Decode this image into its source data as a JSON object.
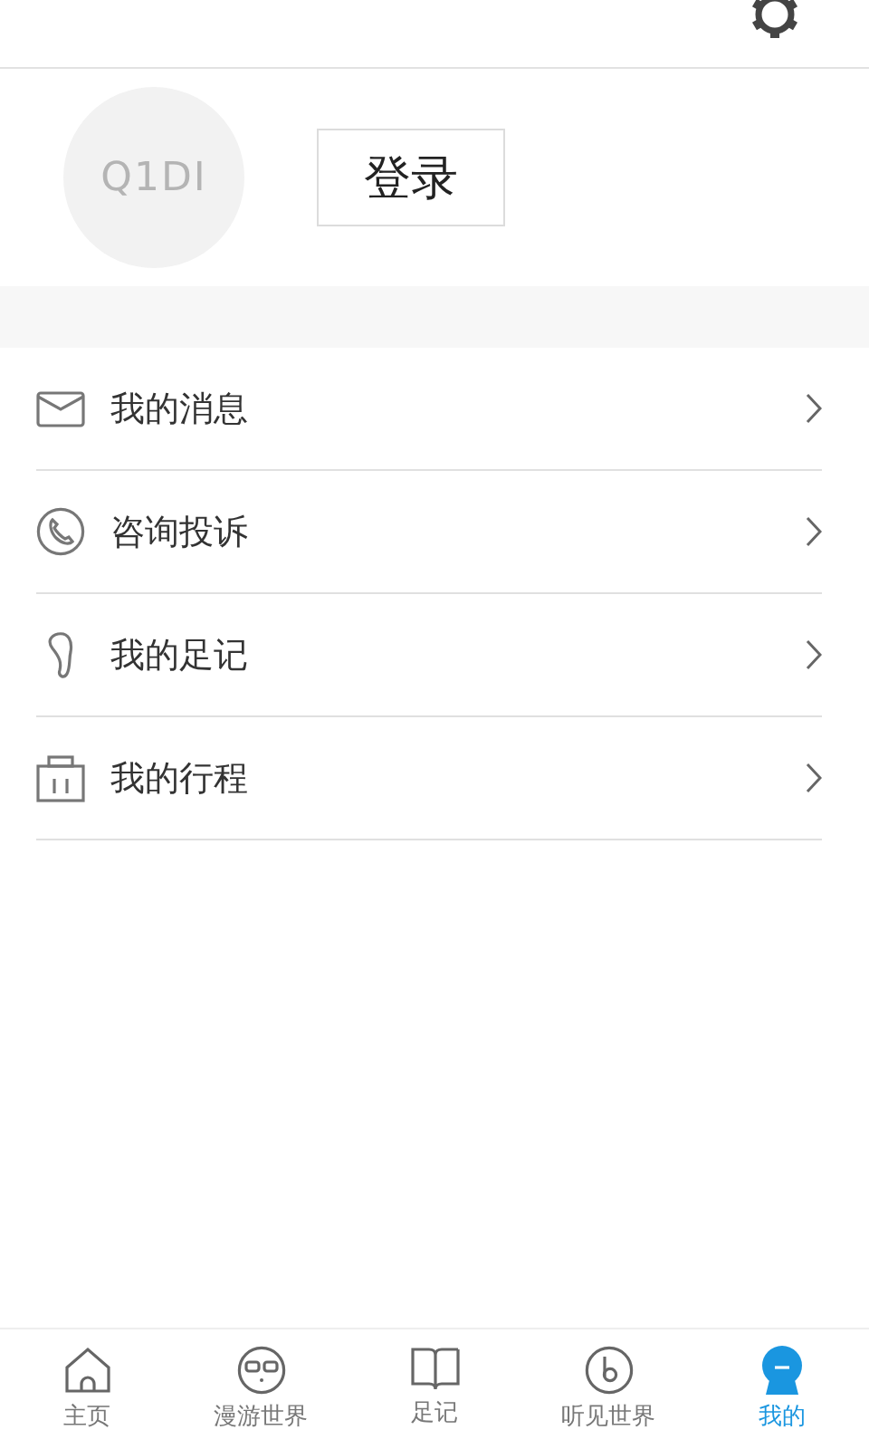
{
  "profile": {
    "avatar_text": "Q1DI",
    "login_button": "登录"
  },
  "menu": [
    {
      "kind": "mail",
      "label": "我的消息"
    },
    {
      "kind": "phone",
      "label": "咨询投诉"
    },
    {
      "kind": "foot",
      "label": "我的足记"
    },
    {
      "kind": "luggage",
      "label": "我的行程"
    }
  ],
  "tabs": [
    {
      "kind": "home",
      "label": "主页",
      "selected": false
    },
    {
      "kind": "face",
      "label": "漫游世界",
      "selected": false
    },
    {
      "kind": "book",
      "label": "足记",
      "selected": false
    },
    {
      "kind": "music",
      "label": "听见世界",
      "selected": false
    },
    {
      "kind": "user",
      "label": "我的",
      "selected": true
    }
  ]
}
